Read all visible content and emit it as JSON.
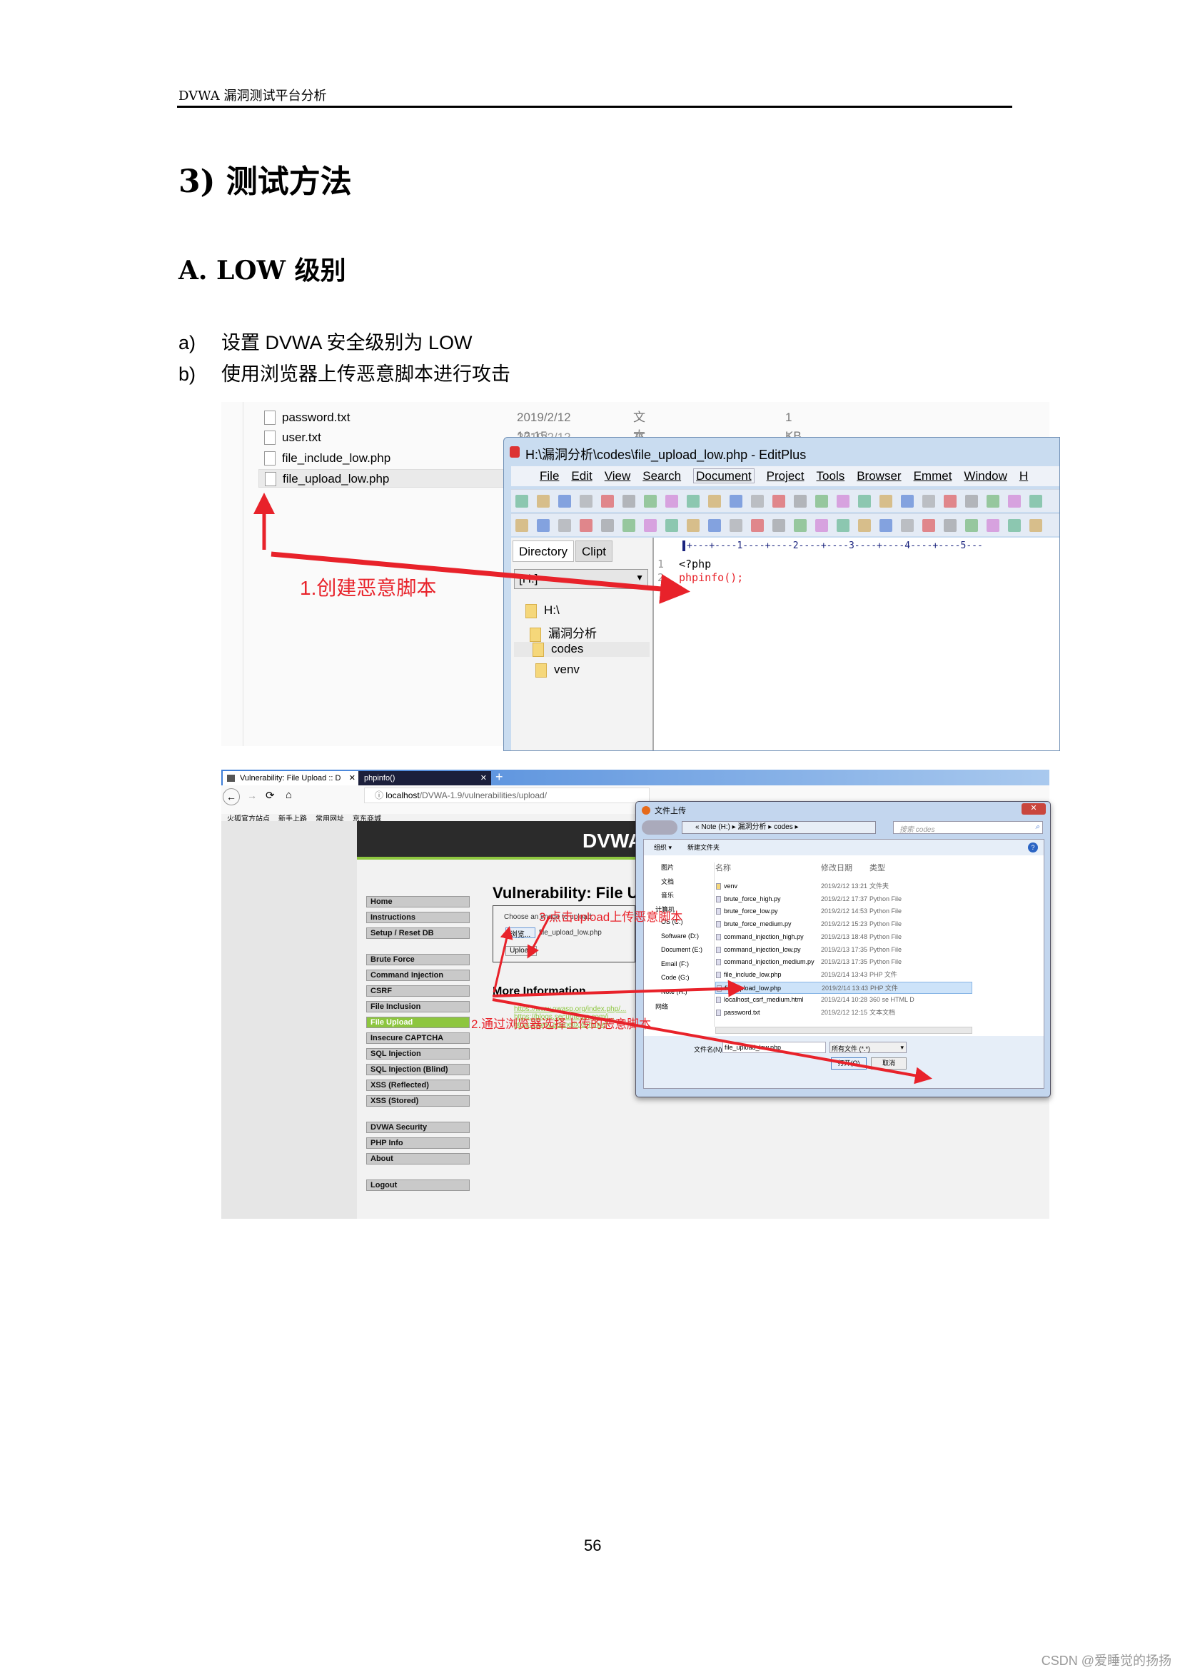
{
  "doc": {
    "header": "DVWA 漏洞测试平台分析",
    "heading1": "3) 测试方法",
    "heading2": "A. LOW 级别",
    "steps": [
      {
        "marker": "a)",
        "text": "设置 DVWA 安全级别为 LOW"
      },
      {
        "marker": "b)",
        "text": "使用浏览器上传恶意脚本进行攻击"
      }
    ],
    "page_number": "56",
    "watermark": "CSDN @爱睡觉的扬扬"
  },
  "shot1": {
    "explorer_rows": [
      {
        "name": "password.txt",
        "date": "2019/2/12 12:15",
        "type": "文本文档",
        "size": "1 KB"
      },
      {
        "name": "user.txt",
        "date": "2019/2/12 12:07",
        "type": "文本文档",
        "size": "1 KB"
      },
      {
        "name": "file_include_low.php"
      },
      {
        "name": "file_upload_low.php",
        "selected": true
      }
    ],
    "editplus": {
      "title": "H:\\漏洞分析\\codes\\file_upload_low.php - EditPlus",
      "menu": [
        "File",
        "Edit",
        "View",
        "Search",
        "Document",
        "Project",
        "Tools",
        "Browser",
        "Emmet",
        "Window",
        "H"
      ],
      "tabs": [
        "Directory",
        "Clipt"
      ],
      "drive": "[H:]",
      "tree": [
        "H:\\",
        "漏洞分析",
        "codes",
        "venv"
      ],
      "selected_folder": "codes",
      "ruler": "+---+----1----+----2----+----3----+----4----+----5---",
      "code": [
        {
          "n": "1",
          "text": "<?php"
        },
        {
          "n": "2",
          "text": "phpinfo();"
        }
      ]
    },
    "annotation": "1.创建恶意脚本"
  },
  "shot2": {
    "tabs": [
      {
        "label": "Vulnerability: File Upload :: D",
        "active": true
      },
      {
        "label": "phpinfo()"
      }
    ],
    "url_host": "localhost",
    "url_path": "/DVWA-1.9/vulnerabilities/upload/",
    "bookmarks": [
      "火狐官方站点",
      "新手上路",
      "常用网址",
      "京东商城"
    ],
    "logo": "DVWA",
    "menu": [
      [
        "Home",
        "Instructions",
        "Setup / Reset DB"
      ],
      [
        "Brute Force",
        "Command Injection",
        "CSRF",
        "File Inclusion",
        "File Upload",
        "Insecure CAPTCHA",
        "SQL Injection",
        "SQL Injection (Blind)",
        "XSS (Reflected)",
        "XSS (Stored)"
      ],
      [
        "DVWA Security",
        "PHP Info",
        "About"
      ],
      [
        "Logout"
      ]
    ],
    "active_menu": "File Upload",
    "accent": "#8dc63f",
    "page_title": "Vulnerability: File U",
    "form": {
      "label": "Choose an image to upload:",
      "browse": "浏览...",
      "file": "file_upload_low.php",
      "upload": "Upload"
    },
    "more_info": "More Information",
    "links": [
      "https://www.owasp.org/index.php/...",
      "https://blogs.securiteam.com/i...",
      "https://www.acunetix.com/wel"
    ],
    "annotations": [
      "3.点击upload上传恶意脚本",
      "2.通过浏览器选择上传的恶意脚本"
    ],
    "dialog": {
      "title": "文件上传",
      "path": [
        "Note (H:)",
        "漏洞分析",
        "codes"
      ],
      "search_placeholder": "搜索 codes",
      "toolbar": [
        "组织 ▾",
        "新建文件夹"
      ],
      "nav": [
        "图片",
        "文档",
        "音乐",
        "计算机",
        "OS (C:)",
        "Software (D:)",
        "Document (E:)",
        "Email (F:)",
        "Code (G:)",
        "Note (H:)",
        "网络"
      ],
      "columns": [
        "名称",
        "修改日期",
        "类型"
      ],
      "files": [
        {
          "name": "venv",
          "date": "2019/2/12 13:21",
          "type": "文件夹"
        },
        {
          "name": "brute_force_high.py",
          "date": "2019/2/12 17:37",
          "type": "Python File"
        },
        {
          "name": "brute_force_low.py",
          "date": "2019/2/12 14:53",
          "type": "Python File"
        },
        {
          "name": "brute_force_medium.py",
          "date": "2019/2/12 15:23",
          "type": "Python File"
        },
        {
          "name": "command_injection_high.py",
          "date": "2019/2/13 18:48",
          "type": "Python File"
        },
        {
          "name": "command_injection_low.py",
          "date": "2019/2/13 17:35",
          "type": "Python File"
        },
        {
          "name": "command_injection_medium.py",
          "date": "2019/2/13 17:35",
          "type": "Python File"
        },
        {
          "name": "file_include_low.php",
          "date": "2019/2/14 13:43",
          "type": "PHP 文件"
        },
        {
          "name": "file_upload_low.php",
          "date": "2019/2/14 13:43",
          "type": "PHP 文件",
          "selected": true
        },
        {
          "name": "localhost_csrf_medium.html",
          "date": "2019/2/14 10:28",
          "type": "360 se HTML D"
        },
        {
          "name": "password.txt",
          "date": "2019/2/12 12:15",
          "type": "文本文档"
        }
      ],
      "filename_label": "文件名(N):",
      "filename": "file_upload_low.php",
      "filter": "所有文件 (*.*)",
      "open": "打开(O)",
      "cancel": "取消"
    }
  }
}
